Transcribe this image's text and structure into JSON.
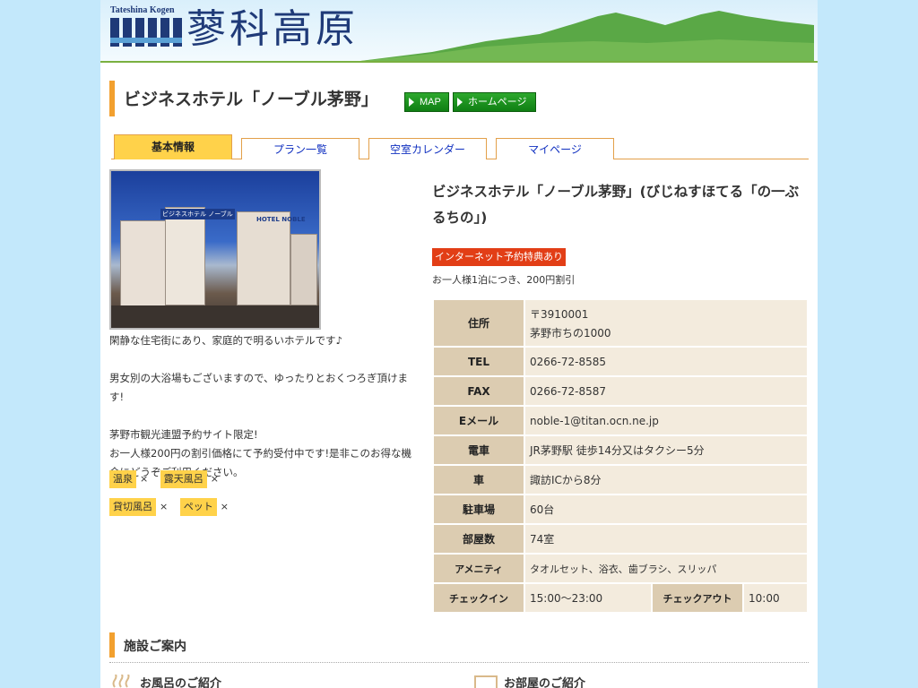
{
  "header": {
    "logo_en": "Tateshina Kogen",
    "logo_jp": "蓼科高原"
  },
  "hotel": {
    "title": "ビジネスホテル「ノーブル茅野」",
    "full_name": "ビジネスホテル「ノーブル茅野」(びじねすほてる「の一ぶるちの」)"
  },
  "buttons": {
    "map": "MAP",
    "homepage": "ホームページ"
  },
  "tabs": [
    {
      "label": "基本情報",
      "active": true
    },
    {
      "label": "プラン一覧",
      "active": false
    },
    {
      "label": "空室カレンダー",
      "active": false
    },
    {
      "label": "マイページ",
      "active": false
    }
  ],
  "photo_signs": {
    "sign1": "ビジネスホテル ノーブル",
    "sign2": "HOTEL NOBLE"
  },
  "description": [
    "閑静な住宅街にあり、家庭的で明るいホテルです♪",
    "",
    "男女別の大浴場もございますので、ゆったりとおくつろぎ頂けます!",
    "",
    "茅野市観光連盟予約サイト限定!",
    "お一人様200円の割引価格にて予約受付中です!是非このお得な機会にどうぞご利用ください。"
  ],
  "features": [
    {
      "label": "温泉",
      "value": "×"
    },
    {
      "label": "露天風呂",
      "value": "×"
    },
    {
      "label": "貸切風呂",
      "value": "×"
    },
    {
      "label": "ペット",
      "value": "×"
    }
  ],
  "badge": {
    "label": "インターネット予約特典あり",
    "note": "お一人様1泊につき、200円割引",
    "color": "#e23e16"
  },
  "info": {
    "address_label": "住所",
    "postal": "〒3910001",
    "address": "茅野市ちの1000",
    "tel_label": "TEL",
    "tel": "0266-72-8585",
    "fax_label": "FAX",
    "fax": "0266-72-8587",
    "email_label": "Eメール",
    "email": "noble-1@titan.ocn.ne.jp",
    "train_label": "電車",
    "train": "JR茅野駅 徒歩14分又はタクシー5分",
    "car_label": "車",
    "car": "諏訪ICから8分",
    "parking_label": "駐車場",
    "parking": "60台",
    "rooms_label": "部屋数",
    "rooms": "74室",
    "amenity_label": "アメニティ",
    "amenity": "タオルセット、浴衣、歯ブラシ、スリッパ",
    "checkin_label": "チェックイン",
    "checkin": "15:00〜23:00",
    "checkout_label": "チェックアウト",
    "checkout": "10:00"
  },
  "facilities": {
    "title": "施設ご案内",
    "bath": "お風呂のご紹介",
    "room": "お部屋のご紹介"
  },
  "colors": {
    "accent_orange": "#f2a02f",
    "tab_active": "#ffd24a",
    "green_button": "#1a9a1e",
    "header_bg": "#c3e8fb"
  }
}
